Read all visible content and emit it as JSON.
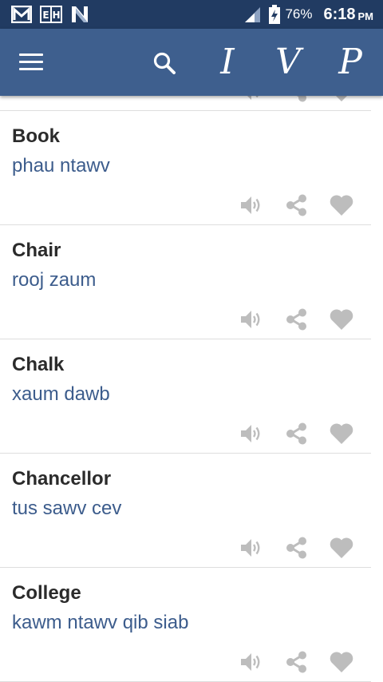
{
  "status_bar": {
    "battery_percent": "76%",
    "time": "6:18",
    "ampm": "PM",
    "notification_icons": [
      "gmail-icon",
      "eh-icon",
      "n-icon"
    ]
  },
  "app_bar": {
    "letter_buttons": [
      "I",
      "V",
      "P"
    ],
    "color": "#3e5f8e"
  },
  "entries": [
    {
      "word": "Book",
      "translation": "phau ntawv"
    },
    {
      "word": "Chair",
      "translation": "rooj zaum"
    },
    {
      "word": "Chalk",
      "translation": "xaum dawb"
    },
    {
      "word": "Chancellor",
      "translation": "tus sawv cev"
    },
    {
      "word": "College",
      "translation": "kawm ntawv qib siab"
    }
  ],
  "colors": {
    "status_bar": "#213b62",
    "translation_text": "#3c5c8c",
    "action_icon": "#bdbdbd"
  }
}
